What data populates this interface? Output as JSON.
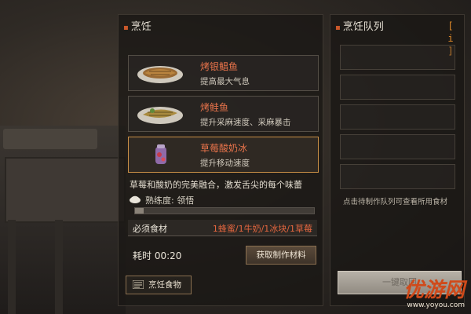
{
  "left_panel": {
    "title": "烹饪",
    "recipes": [
      {
        "name": "烤银鲳鱼",
        "desc": "提高最大气息",
        "icon": "grilled-fish-icon"
      },
      {
        "name": "烤鲑鱼",
        "desc": "提升采麻速度、采麻暴击",
        "icon": "grilled-salmon-icon"
      },
      {
        "name": "草莓酸奶冰",
        "desc": "提升移动速度",
        "icon": "strawberry-yogurt-icon"
      }
    ],
    "selected_description": "草莓和酸奶的完美融合，激发舌尖的每个味蕾",
    "proficiency_text": "熟练度: 领悟",
    "proficiency_progress": 0.05,
    "ingredients_label": "必须食材",
    "ingredients_value": "1蜂蜜/1牛奶/1冰块/1草莓",
    "time_label": "耗时 00:20",
    "get_materials_button": "获取制作材料",
    "cook_food_button": "烹饪食物"
  },
  "right_panel": {
    "title": "烹饪队列",
    "info_button": "[ i ]",
    "queue_hint": "点击待制作队列可查看所用食材",
    "one_click_button": "一键取回"
  },
  "watermark": {
    "logo": "优游网",
    "url": "www.yoyou.com"
  },
  "colors": {
    "accent_orange": "#e4663f",
    "selected_border": "#c98f46",
    "title_dot": "#c9582a"
  }
}
